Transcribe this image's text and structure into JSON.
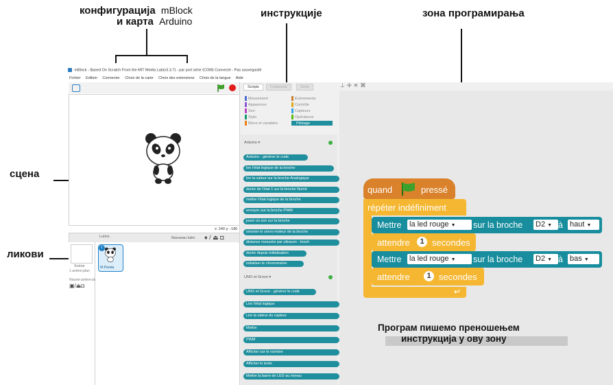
{
  "annotations": {
    "config_line1": "конфигурација",
    "config_line1_right": "mBlock",
    "config_line2": "и карта",
    "config_line2_right": "Arduino",
    "instructions": "инструкције",
    "programming_zone": "зона програмирања",
    "stage": "сцена",
    "sprites": "ликови",
    "bottom_line1": "Програм пишемо преношењем",
    "bottom_line2": "инструкција у ову зону"
  },
  "window": {
    "title": "mBlock - Based On Scratch From the MIT Media Lab(v3.3.7) - par port série (COM) Connecté - Pas sauvegardé",
    "menu": [
      "Fichier",
      "Edition",
      "Connecter",
      "Choix de la carte",
      "Choix des extensions",
      "Choix de la langue",
      "Aide"
    ]
  },
  "stage_panel": {
    "coords": "x: 240  y: -180"
  },
  "sprites_panel": {
    "lutin_header": "Lutins",
    "new_sprite": "Nouveau lutin:",
    "scene_label": "Scène",
    "scene_sub": "1 arrière-plan",
    "new_backdrop": "Nouvel arrière-plan:",
    "sprite_name": "M-Panda",
    "sprite_badge": "i"
  },
  "tabs": [
    "Scripts",
    "Costumes",
    "Sons"
  ],
  "categories_left": [
    "Mouvement",
    "Apparence",
    "Son",
    "Stylo",
    "Blocs et variables"
  ],
  "categories_right": [
    "Événements",
    "Contrôle",
    "Capteurs",
    "Opérateurs",
    "Pilotage"
  ],
  "category_colors_left": [
    "#4a6cd4",
    "#8a55d7",
    "#bb42c3",
    "#0e9a6c",
    "#ee7d16"
  ],
  "category_colors_right": [
    "#c88330",
    "#e1a91a",
    "#2ca5e2",
    "#5cb712",
    "#1f8f9d"
  ],
  "palette": {
    "arduino_header": "Arduino ▾",
    "arduino_blocks": [
      "Arduino - générer le code",
      "lire l'état logique de la broche",
      "lire la valeur sur la broche Analogique",
      "durée de l'état 1 sur la broche Numé",
      "mettre l'état logique de la broche",
      "envoyer sur la broche PWM",
      "jouer un son sur la broche",
      "orienter le servo-moteur de la broche",
      "distance mesurée par ultrason : broch",
      "durée depuis initialisation",
      "initialiser le chronomètre"
    ],
    "grove_header": "UNO et Grove ▾",
    "grove_blocks": [
      "UNO et Grove - générer le code",
      "Lire l'état logique",
      "Lire la valeur du capteur",
      "Mettre",
      "PWM",
      "Afficher sur le nombre",
      "Afficher le texte",
      "Mettre la barre de LED au niveau"
    ],
    "grove_inline": [
      "<Selectionner>",
      "<Selectionner>",
      "<Selectionner>",
      "<Selectionner>",
      "<Selectionner>",
      "<Selectionner>"
    ]
  },
  "script": {
    "hat_text_left": "quand",
    "hat_text_right": "pressé",
    "repeat_label": "répéter indéfiniment",
    "set1": {
      "mettre": "Mettre",
      "led": "la led rouge",
      "sur": "sur la broche",
      "pin": "D2",
      "a": "à",
      "state": "haut"
    },
    "wait1": {
      "label": "attendre",
      "value": "1",
      "unit": "secondes"
    },
    "set2": {
      "mettre": "Mettre",
      "led": "la led rouge",
      "sur": "sur la broche",
      "pin": "D2",
      "a": "à",
      "state": "bas"
    },
    "wait2": {
      "label": "attendre",
      "value": "1",
      "unit": "secondes"
    }
  },
  "colors": {
    "hat": "#d9822b",
    "control": "#f5b731",
    "robot": "#178d9d",
    "script_bg": "#e8e8e8"
  }
}
